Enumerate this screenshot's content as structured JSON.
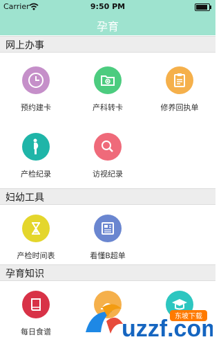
{
  "status_bar": {
    "carrier": "Carrier",
    "time": "9:50 PM",
    "battery_level": 0.9
  },
  "nav": {
    "title": "孕育"
  },
  "sections": [
    {
      "title": "网上办事",
      "items": [
        {
          "label": "预约建卡",
          "icon": "clock-icon",
          "color": "#c58fc9"
        },
        {
          "label": "产科转卡",
          "icon": "folder-plus-icon",
          "color": "#4ccc7f"
        },
        {
          "label": "修养回执单",
          "icon": "clipboard-icon",
          "color": "#f5b04b"
        },
        {
          "label": "产检纪录",
          "icon": "pregnant-woman-icon",
          "color": "#1fb5a8"
        },
        {
          "label": "访视纪录",
          "icon": "search-icon",
          "color": "#ef6a7a"
        }
      ]
    },
    {
      "title": "妇幼工具",
      "items": [
        {
          "label": "产检时间表",
          "icon": "hourglass-icon",
          "color": "#e4d62c"
        },
        {
          "label": "看懂B超单",
          "icon": "report-icon",
          "color": "#6a86d0"
        }
      ]
    },
    {
      "title": "孕育知识",
      "items": [
        {
          "label": "每日食谱",
          "icon": "book-icon",
          "color": "#d83247"
        },
        {
          "label": "",
          "icon": "sun-icon",
          "color": "#f5b04b"
        },
        {
          "label": "",
          "icon": "graduation-cap-icon",
          "color": "#2dc6c0"
        }
      ]
    }
  ],
  "watermark": {
    "text": "uzzf.com",
    "badge": "东坡下载"
  }
}
